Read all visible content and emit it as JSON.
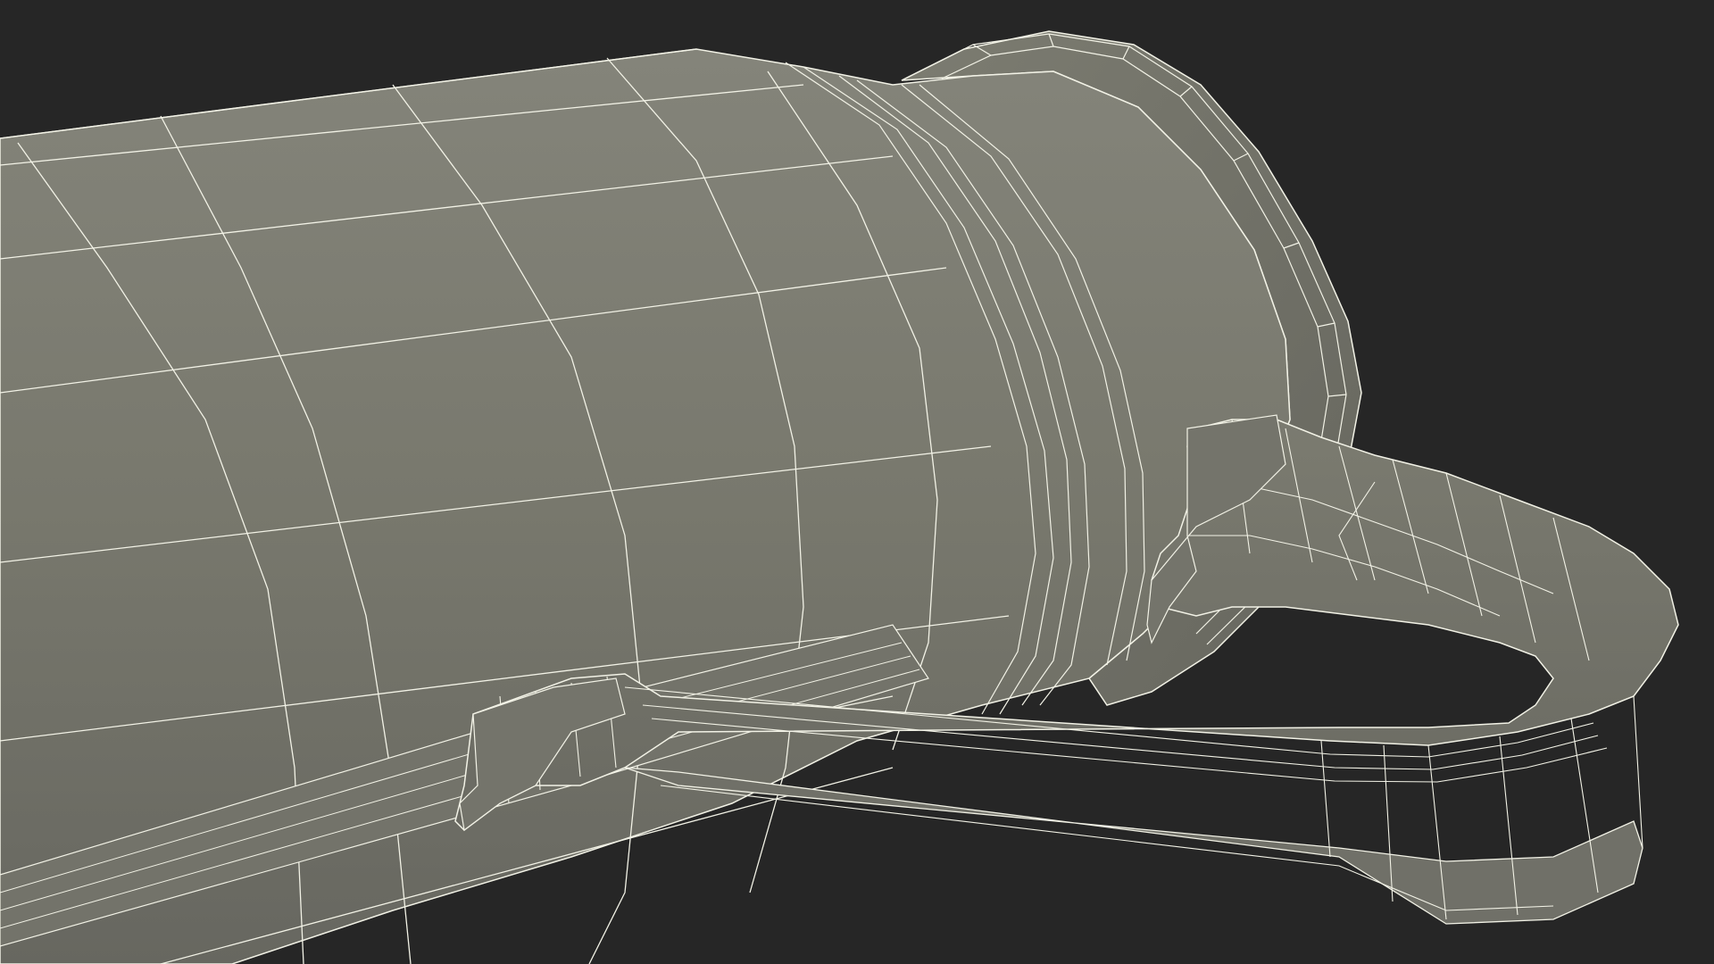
{
  "scene": {
    "background_color": "#262626",
    "surface_color": "#78786c",
    "surface_shade_color": "#6a6a60",
    "surface_light_color": "#85857a",
    "wire_color": "#f2f2e6",
    "object_description_icon": "wireframe-mesh"
  }
}
